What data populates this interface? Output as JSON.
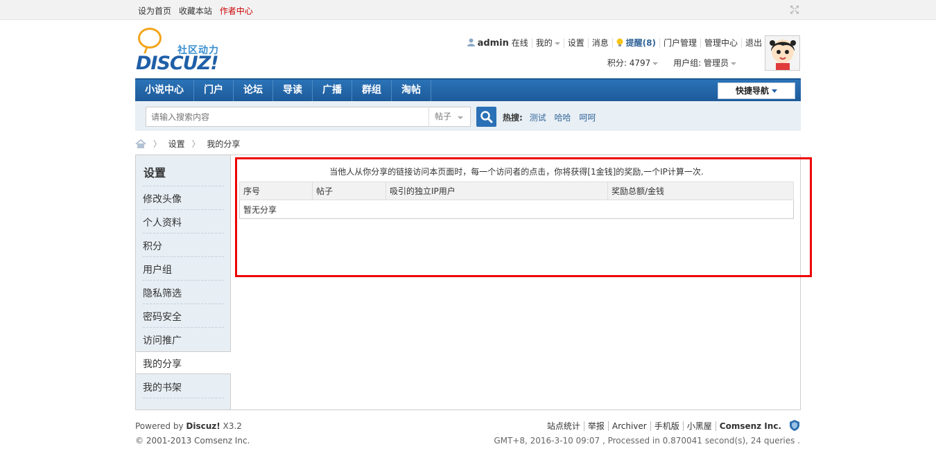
{
  "topbar": {
    "links": [
      "设为首页",
      "收藏本站"
    ],
    "author_center": "作者中心"
  },
  "logo": {
    "tagline": "社区动力",
    "word": "DISCUZ!"
  },
  "usernav": {
    "username": "admin",
    "status": "在线",
    "my": "我的",
    "settings": "设置",
    "messages": "消息",
    "notice": "提醒(8)",
    "portal_manage": "门户管理",
    "admin_center": "管理中心",
    "logout": "退出",
    "credits": "积分: 4797",
    "usergroup": "用户组: 管理员"
  },
  "nav": {
    "items": [
      "小说中心",
      "门户",
      "论坛",
      "导读",
      "广播",
      "群组",
      "淘帖"
    ],
    "quick_nav": "快捷导航"
  },
  "search": {
    "placeholder": "请输入搜索内容",
    "type": "帖子",
    "hot_label": "热搜:",
    "hot_keywords": [
      "测试",
      "哈哈",
      "呵呵"
    ]
  },
  "breadcrumb": [
    "设置",
    "我的分享"
  ],
  "sidebar": {
    "title": "设置",
    "items": [
      "修改头像",
      "个人资料",
      "积分",
      "用户组",
      "隐私筛选",
      "密码安全",
      "访问推广",
      "我的分享",
      "我的书架"
    ],
    "active_index": 7
  },
  "content": {
    "notice": "当他人从你分享的链接访问本页面时，每一个访问者的点击，你将获得[1金钱]的奖励,一个IP计算一次.",
    "columns": [
      "序号",
      "帖子",
      "吸引的独立IP用户",
      "奖励总额/金钱"
    ],
    "empty": "暂无分享"
  },
  "footer": {
    "powered_prefix": "Powered by ",
    "powered_brand": "Discuz!",
    "version": " X3.2",
    "copyright": "© 2001-2013 Comsenz Inc.",
    "links": [
      "站点统计",
      "举报",
      "Archiver",
      "手机版",
      "小黑屋"
    ],
    "company": "Comsenz Inc.",
    "stats": "GMT+8, 2016-3-10 09:07 , Processed in 0.870041 second(s), 24 queries ."
  },
  "colors": {
    "nav_blue": "#2b73b7",
    "accent_red": "#e00",
    "link_blue": "#336699"
  }
}
